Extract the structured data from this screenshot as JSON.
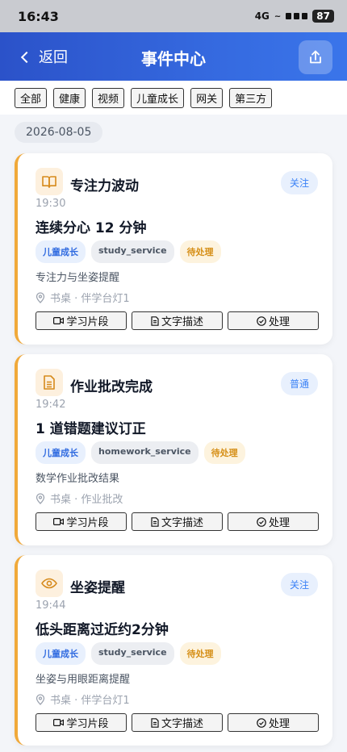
{
  "status_bar": {
    "time": "16:43",
    "network": "4G",
    "battery": "87"
  },
  "header": {
    "back_label": "返回",
    "title": "事件中心"
  },
  "filters": [
    "全部",
    "健康",
    "视频",
    "儿童成长",
    "网关",
    "第三方"
  ],
  "date_group": "2026-08-05",
  "events": [
    {
      "icon": "book-icon",
      "title": "专注力波动",
      "priority": "关注",
      "time": "19:30",
      "headline": "连续分心 12 分钟",
      "category": "儿童成长",
      "service": "study_service",
      "status": "待处理",
      "description": "专注力与坐姿提醒",
      "location": "书桌 · 伴学台灯1",
      "actions": [
        "学习片段",
        "文字描述",
        "处理"
      ]
    },
    {
      "icon": "document-icon",
      "title": "作业批改完成",
      "priority": "普通",
      "time": "19:42",
      "headline": "1 道错题建议订正",
      "category": "儿童成长",
      "service": "homework_service",
      "status": "待处理",
      "description": "数学作业批改结果",
      "location": "书桌 · 作业批改",
      "actions": [
        "学习片段",
        "文字描述",
        "处理"
      ]
    },
    {
      "icon": "eye-icon",
      "title": "坐姿提醒",
      "priority": "关注",
      "time": "19:44",
      "headline": "低头距离过近约2分钟",
      "category": "儿童成长",
      "service": "study_service",
      "status": "待处理",
      "description": "坐姿与用眼距离提醒",
      "location": "书桌 · 伴学台灯1",
      "actions": [
        "学习片段",
        "文字描述",
        "处理"
      ]
    }
  ]
}
